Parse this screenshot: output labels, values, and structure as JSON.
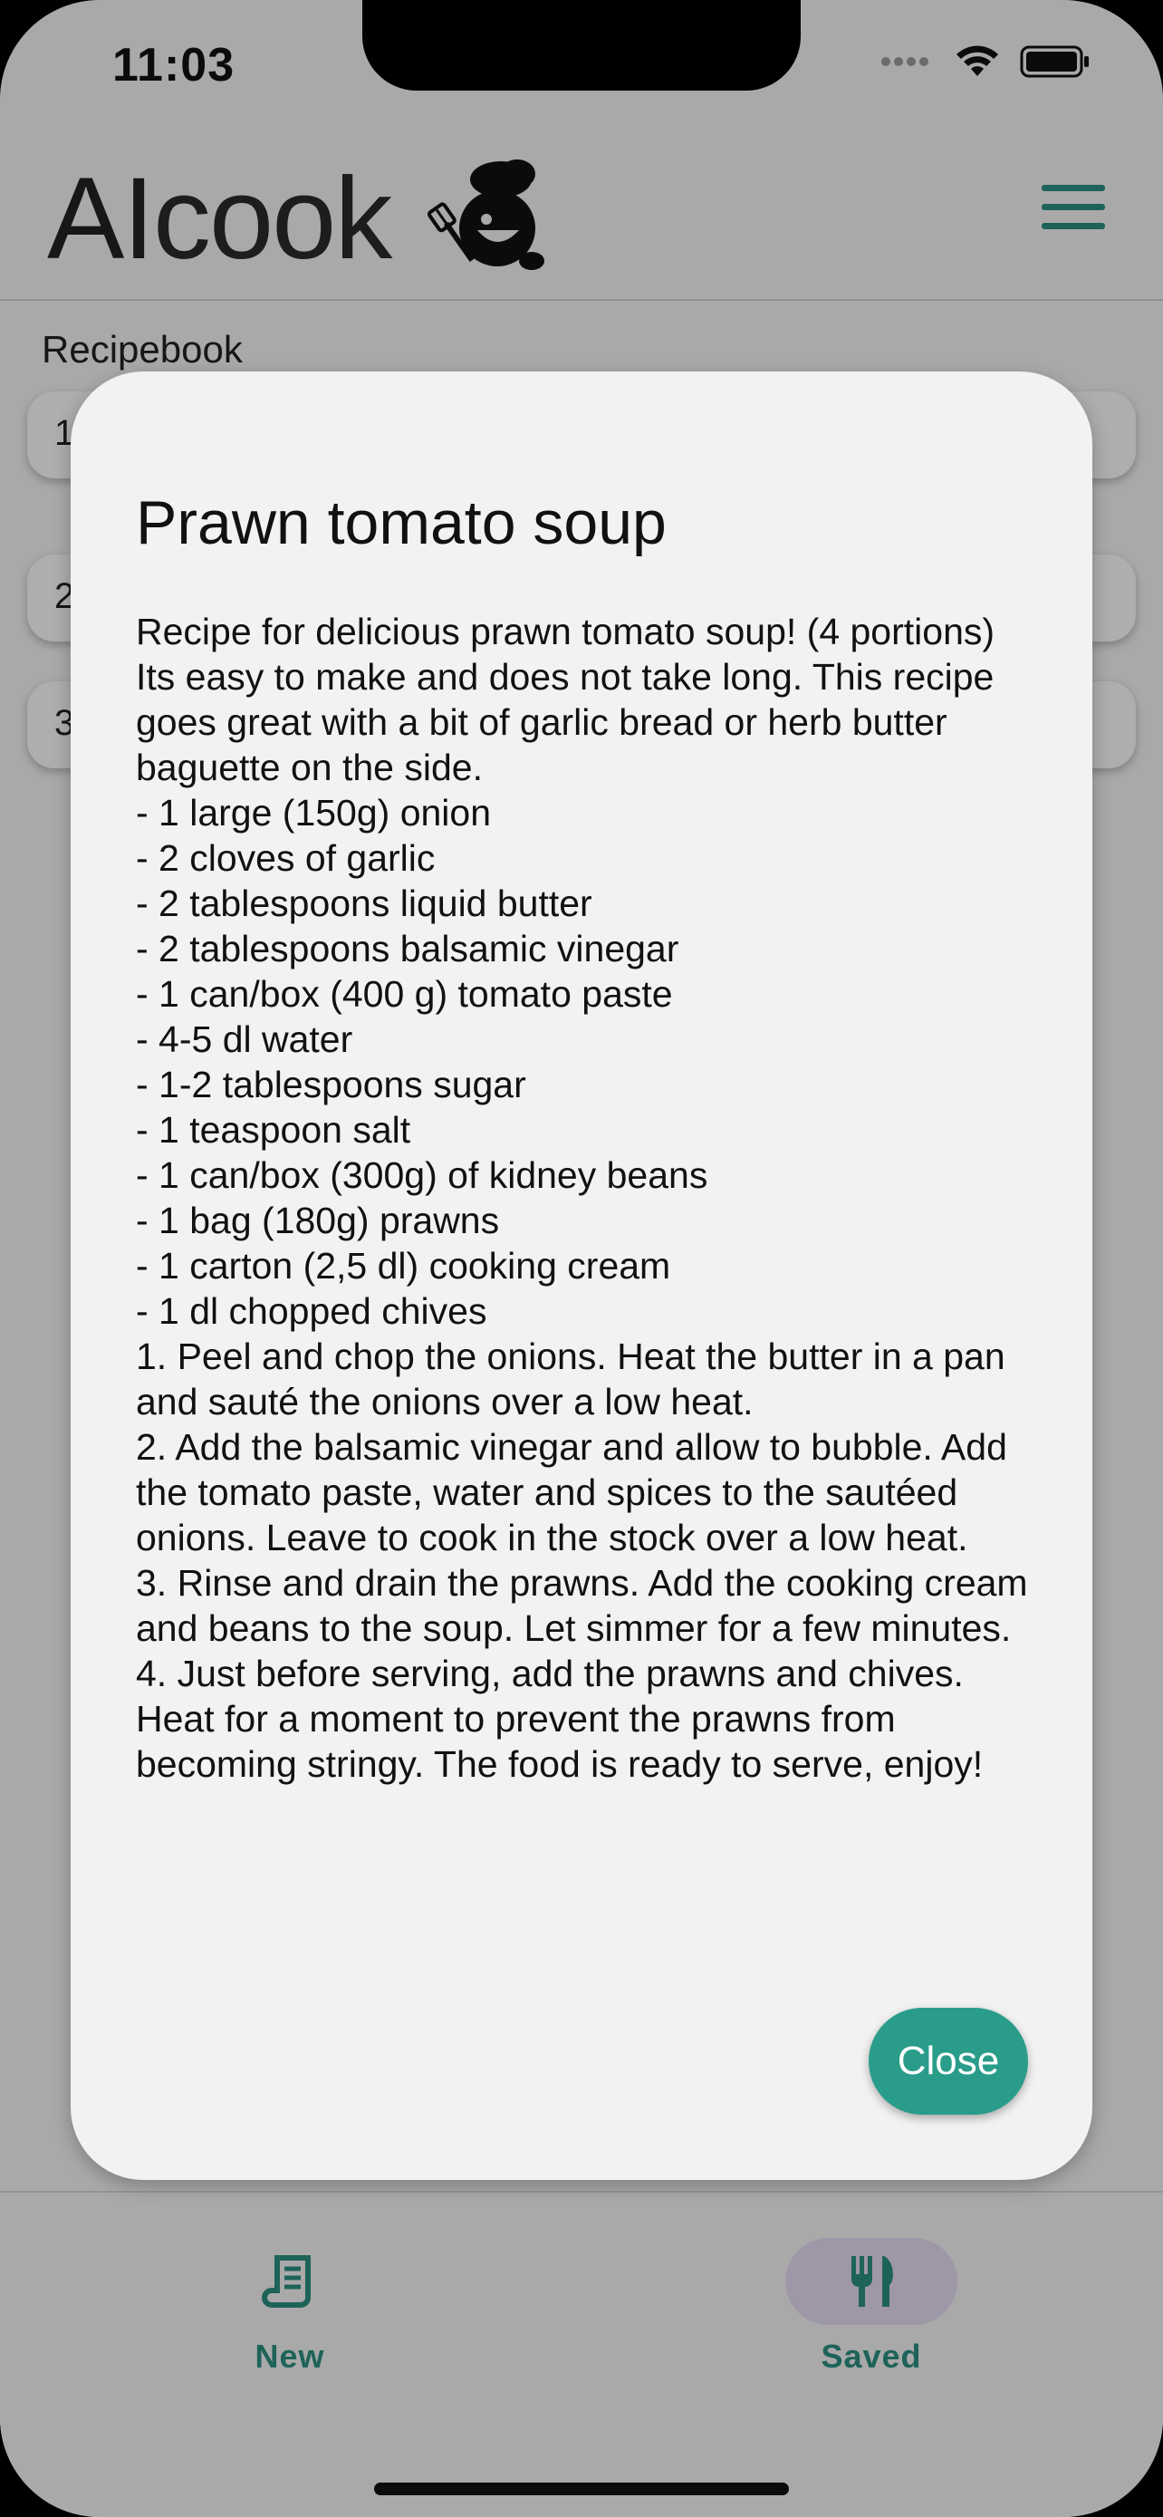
{
  "status_bar": {
    "time": "11:03"
  },
  "header": {
    "logo_text_ai": "AI",
    "logo_text_cook": "cook",
    "menu_icon": "hamburger-menu-icon",
    "accent_color": "#2b8f80"
  },
  "page": {
    "title": "Recipebook",
    "rows": [
      {
        "num": "1"
      },
      {
        "num": "2"
      },
      {
        "num": "3"
      }
    ]
  },
  "dialog": {
    "title": "Prawn tomato soup",
    "body": "Recipe for delicious prawn tomato soup! (4 portions) Its easy to make and does not take long. This recipe goes great with a bit of garlic bread or herb butter baguette on the side.\n- 1 large (150g) onion\n- 2 cloves of garlic\n- 2 tablespoons liquid butter\n- 2 tablespoons balsamic vinegar\n- 1 can/box (400 g) tomato paste\n- 4-5 dl water\n- 1-2 tablespoons sugar\n- 1 teaspoon salt\n- 1 can/box (300g) of kidney beans\n- 1 bag (180g) prawns\n- 1 carton (2,5 dl) cooking cream\n- 1 dl chopped chives\n1. Peel and chop the onions. Heat the butter in a pan and sauté the onions over a low heat.\n2. Add the balsamic vinegar and allow to bubble. Add the tomato paste, water and spices to the sautéed onions. Leave to cook in the stock over a low heat.\n3. Rinse and drain the prawns. Add the cooking cream and beans to the soup. Let simmer for a few minutes.\n4. Just before serving, add the prawns and chives. Heat for a moment to prevent the prawns from becoming stringy. The food is ready to serve, enjoy!",
    "close_label": "Close",
    "close_color": "#2a9d8a"
  },
  "bottom_nav": {
    "items": [
      {
        "label": "New",
        "icon": "recipe-scroll-icon",
        "selected": false
      },
      {
        "label": "Saved",
        "icon": "fork-knife-icon",
        "selected": true
      }
    ]
  }
}
